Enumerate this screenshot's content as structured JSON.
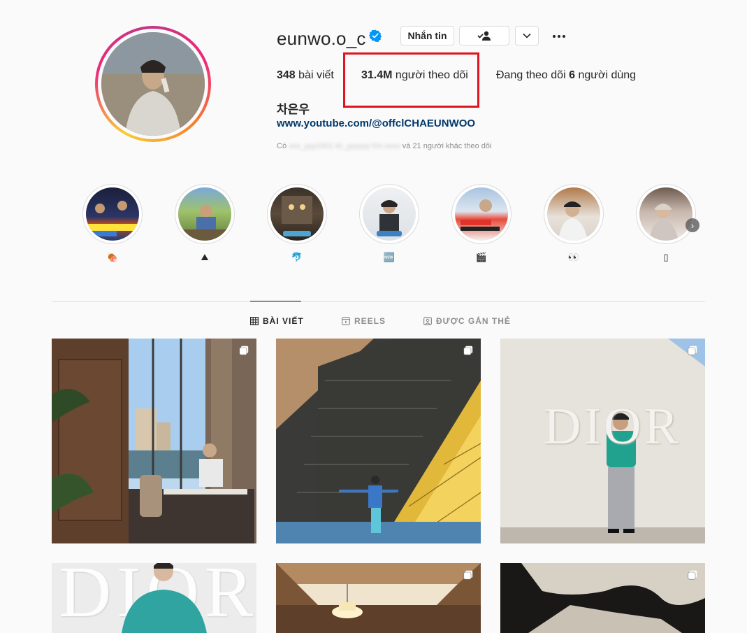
{
  "profile": {
    "username": "eunwo.o_c",
    "verified": true,
    "buttons": {
      "message": "Nhắn tin",
      "following_icon": "person-check-icon",
      "suggest_icon": "chevron-down-icon"
    },
    "stats": {
      "posts_count": "348",
      "posts_label": "bài viết",
      "followers_count": "31.4M",
      "followers_label": "người theo dõi",
      "following_prefix": "Đang theo dõi",
      "following_count": "6",
      "following_suffix": "người dùng"
    },
    "full_name": "차은우",
    "website": "www.youtube.com/@offclCHAEUNWOO",
    "followed_by": {
      "prefix": "Có",
      "names_blurred": "xxx_yyy1001 từ_yyyyyy hm.xxxx",
      "suffix": "và 21 người khác theo dõi"
    }
  },
  "highlights": [
    {
      "emoji": "🍖"
    },
    {
      "emoji": "⛰"
    },
    {
      "emoji": "🐬"
    },
    {
      "emoji": "🆕"
    },
    {
      "emoji": "🎬"
    },
    {
      "emoji": "👀"
    },
    {
      "emoji": "▯"
    }
  ],
  "tabs": [
    {
      "label": "BÀI VIẾT",
      "icon": "grid-icon",
      "active": true
    },
    {
      "label": "REELS",
      "icon": "reels-icon",
      "active": false
    },
    {
      "label": "ĐƯỢC GẮN THẺ",
      "icon": "tagged-icon",
      "active": false
    }
  ],
  "posts": [
    {
      "text": ""
    },
    {
      "text": ""
    },
    {
      "text": "DIOR"
    },
    {
      "text": "DIOR"
    },
    {
      "text": ""
    },
    {
      "text": ""
    }
  ],
  "colors": {
    "highlight_box": "#e0141e",
    "verified": "#0095f6",
    "link": "#00376b"
  }
}
